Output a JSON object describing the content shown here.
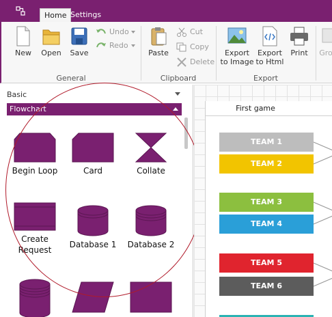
{
  "tabs": {
    "home": "Home",
    "settings": "Settings"
  },
  "ribbon": {
    "new": "New",
    "open": "Open",
    "save": "Save",
    "undo": "Undo",
    "redo": "Redo",
    "paste": "Paste",
    "cut": "Cut",
    "copy": "Copy",
    "delete": "Delete",
    "export_image_line1": "Export",
    "export_image_line2": "to Image",
    "export_html_line1": "Export",
    "export_html_line2": "to Html",
    "print": "Print",
    "group_truncated": "Gro",
    "groups": {
      "general": "General",
      "clipboard": "Clipboard",
      "export": "Export"
    }
  },
  "panel": {
    "category": "Basic",
    "section": "Flowchart",
    "shapes": [
      {
        "label_line1": "Begin Loop",
        "label_line2": ""
      },
      {
        "label_line1": "Card",
        "label_line2": ""
      },
      {
        "label_line1": "Collate",
        "label_line2": ""
      },
      {
        "label_line1": "Create",
        "label_line2": "Request"
      },
      {
        "label_line1": "Database 1",
        "label_line2": ""
      },
      {
        "label_line1": "Database 2",
        "label_line2": ""
      }
    ]
  },
  "canvas": {
    "column_title": "First game",
    "teams": [
      {
        "name": "TEAM 1",
        "color": "#bdbdbd"
      },
      {
        "name": "TEAM 2",
        "color": "#f2c400"
      },
      {
        "name": "TEAM 3",
        "color": "#8cbf3f"
      },
      {
        "name": "TEAM 4",
        "color": "#2a9fd8"
      },
      {
        "name": "TEAM 5",
        "color": "#e0242e"
      },
      {
        "name": "TEAM 6",
        "color": "#5c5c5c"
      }
    ]
  },
  "colors": {
    "accent": "#7a2070",
    "highlight": "#b01a2a"
  }
}
